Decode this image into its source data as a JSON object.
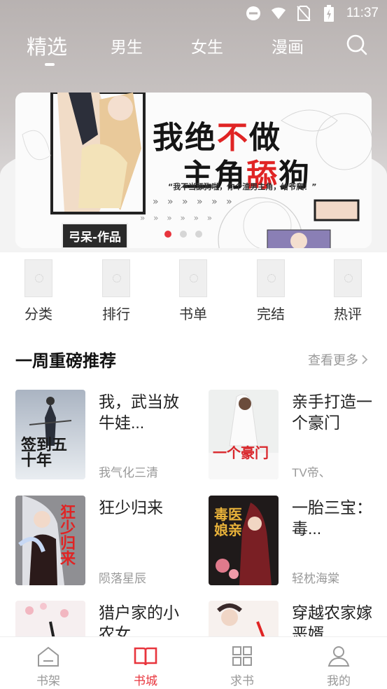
{
  "status_bar": {
    "time": "11:37",
    "icons": [
      "dnd-icon",
      "wifi-icon",
      "no-sim-icon",
      "battery-charging-icon"
    ]
  },
  "top_tabs": [
    {
      "label": "精选",
      "active": true
    },
    {
      "label": "男生",
      "active": false
    },
    {
      "label": "女生",
      "active": false
    },
    {
      "label": "漫画",
      "active": false
    }
  ],
  "banner": {
    "title_line1_a": "我绝",
    "title_line1_hl": "不",
    "title_line1_b": "做",
    "title_line2_a": "主角",
    "title_line2_hl": "舔",
    "title_line2_b": "狗",
    "quote": "“我不当舔狗啦，你个渣男主角，给爷爬！”",
    "arrows": "» » » » » »",
    "arrows2": "» » » » » »",
    "author_tag": "弓呆-作品",
    "slide_count": 3,
    "active_slide": 0
  },
  "categories": [
    {
      "label": "分类"
    },
    {
      "label": "排行"
    },
    {
      "label": "书单"
    },
    {
      "label": "完结"
    },
    {
      "label": "热评"
    }
  ],
  "section": {
    "title": "一周重磅推荐",
    "see_more": "查看更多"
  },
  "books": [
    {
      "title": "我，武当放牛娃...",
      "author": "我气化三清",
      "cover_text": "签到五十年"
    },
    {
      "title": "亲手打造一个豪门",
      "author": "TV帝、",
      "cover_text": "一个豪门"
    },
    {
      "title": "狂少归来",
      "author": "陨落星辰",
      "cover_text": "狂少归来"
    },
    {
      "title": "一胎三宝：毒...",
      "author": "轻枕海棠",
      "cover_text": "毒医娘亲"
    },
    {
      "title": "猎户家的小农女",
      "author": "",
      "cover_text": ""
    },
    {
      "title": "穿越农家嫁恶婿",
      "author": "",
      "cover_text": ""
    }
  ],
  "bottom_nav": [
    {
      "label": "书架",
      "icon": "bookshelf-icon",
      "active": false
    },
    {
      "label": "书城",
      "icon": "open-book-icon",
      "active": true
    },
    {
      "label": "求书",
      "icon": "grid-icon",
      "active": false
    },
    {
      "label": "我的",
      "icon": "user-icon",
      "active": false
    }
  ],
  "colors": {
    "accent": "#e8353d",
    "muted": "#999999"
  }
}
